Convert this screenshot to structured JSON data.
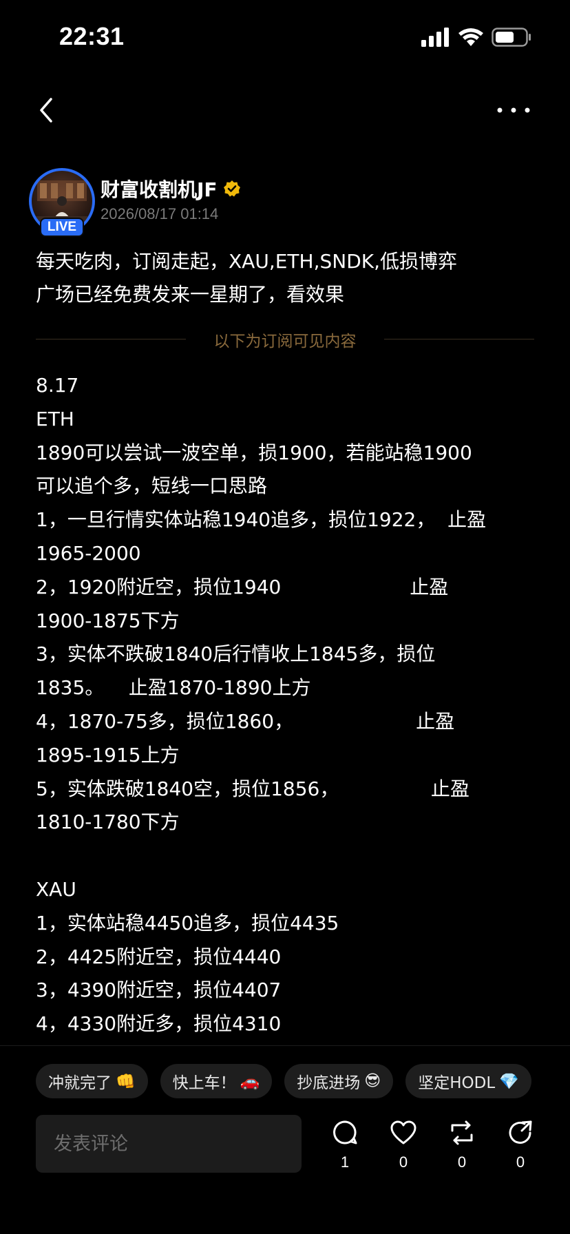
{
  "status_bar": {
    "time": "22:31",
    "icons": [
      "cellular-signal-icon",
      "wifi-icon",
      "battery-icon"
    ]
  },
  "nav": {
    "back_icon": "chevron-left-icon",
    "more_icon": "more-horizontal-icon"
  },
  "author": {
    "name": "财富收割机JF",
    "verified_icon": "verified-badge-icon",
    "live_badge": "LIVE",
    "post_time": "2026/08/17 01:14"
  },
  "post": {
    "intro": "每天吃肉，订阅走起，XAU,ETH,SNDK,低损博弈\n广场已经免费发来一星期了，看效果",
    "divider_label": "以下为订阅可见内容",
    "paid_lines": [
      "8.17",
      "ETH",
      "1890可以尝试一波空单，损1900，若能站稳1900",
      "可以追个多，短线一口思路",
      "1，一旦行情实体站稳1940追多，损位1922，  止盈",
      "1965-2000",
      "2，1920附近空，损位1940                     止盈",
      "1900-1875下方",
      "3，实体不跌破1840后行情收上1845多，损位",
      "1835。    止盈1870-1890上方",
      "4，1870-75多，损位1860，                    止盈",
      "1895-1915上方",
      "5，实体跌破1840空，损位1856，               止盈",
      "1810-1780下方",
      "",
      "XAU",
      "1，实体站稳4450追多，损位4435",
      "2，4425附近空，损位4440",
      "3，4390附近空，损位4407",
      "4，4330附近多，损位4310"
    ]
  },
  "quick_replies": [
    {
      "text": "冲就完了",
      "emoji": "👊"
    },
    {
      "text": "快上车！",
      "emoji": "🚗"
    },
    {
      "text": "抄底进场",
      "emoji": "😎"
    },
    {
      "text": "坚定HODL",
      "emoji": "💎"
    }
  ],
  "comment": {
    "placeholder": "发表评论"
  },
  "actions": [
    {
      "icon": "comment-icon",
      "count": "1"
    },
    {
      "icon": "heart-icon",
      "count": "0"
    },
    {
      "icon": "repost-icon",
      "count": "0"
    },
    {
      "icon": "share-icon",
      "count": "0"
    }
  ],
  "colors": {
    "background": "#000000",
    "accent_blue": "#2a6cf5",
    "verified_gold": "#f0b90b",
    "divider_gold": "#8a6a3c",
    "muted_text": "#7a7a7a"
  }
}
